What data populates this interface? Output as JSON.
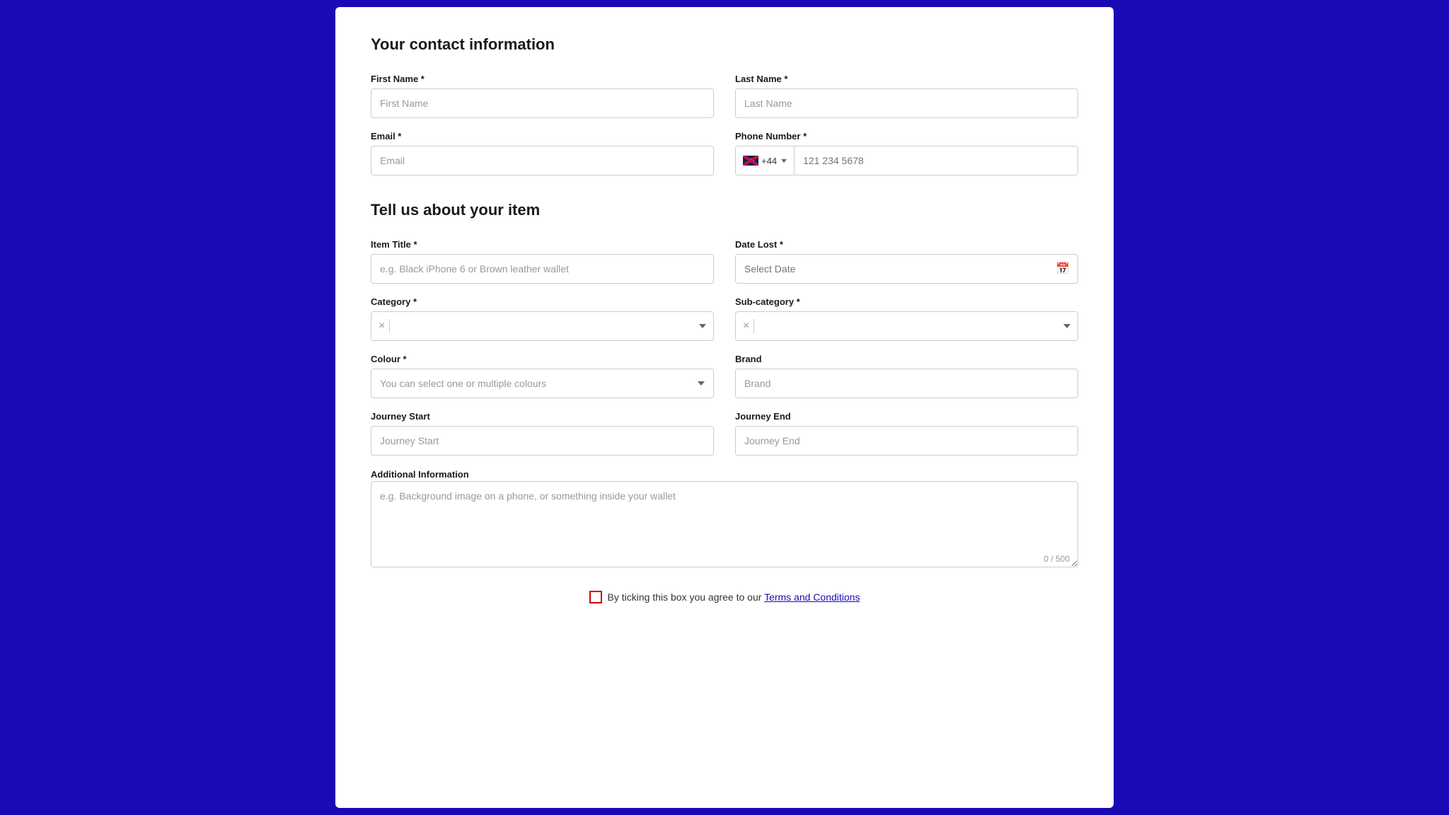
{
  "page": {
    "background_color": "#1a0ab5"
  },
  "contact_section": {
    "title": "Your contact information",
    "first_name": {
      "label": "First Name *",
      "placeholder": "First Name"
    },
    "last_name": {
      "label": "Last Name *",
      "placeholder": "Last Name"
    },
    "email": {
      "label": "Email *",
      "placeholder": "Email"
    },
    "phone": {
      "label": "Phone Number *",
      "country_code": "+44",
      "placeholder": "121 234 5678"
    }
  },
  "item_section": {
    "title": "Tell us about your item",
    "item_title": {
      "label": "Item Title *",
      "placeholder": "e.g. Black iPhone 6 or Brown leather wallet"
    },
    "date_lost": {
      "label": "Date Lost *",
      "placeholder": "Select Date"
    },
    "category": {
      "label": "Category *",
      "placeholder": ""
    },
    "sub_category": {
      "label": "Sub-category *",
      "placeholder": ""
    },
    "colour": {
      "label": "Colour *",
      "placeholder": "You can select one or multiple colours"
    },
    "brand": {
      "label": "Brand",
      "placeholder": "Brand"
    },
    "journey_start": {
      "label": "Journey Start",
      "placeholder": "Journey Start"
    },
    "journey_end": {
      "label": "Journey End",
      "placeholder": "Journey End"
    },
    "additional_info": {
      "label": "Additional Information",
      "placeholder": "e.g. Background image on a phone, or something inside your wallet",
      "char_count": "0 / 500"
    }
  },
  "terms": {
    "text": "By ticking this box you agree to our ",
    "link_text": "Terms and Conditions"
  },
  "icons": {
    "calendar": "📅",
    "clear": "×",
    "chevron": "▼"
  }
}
